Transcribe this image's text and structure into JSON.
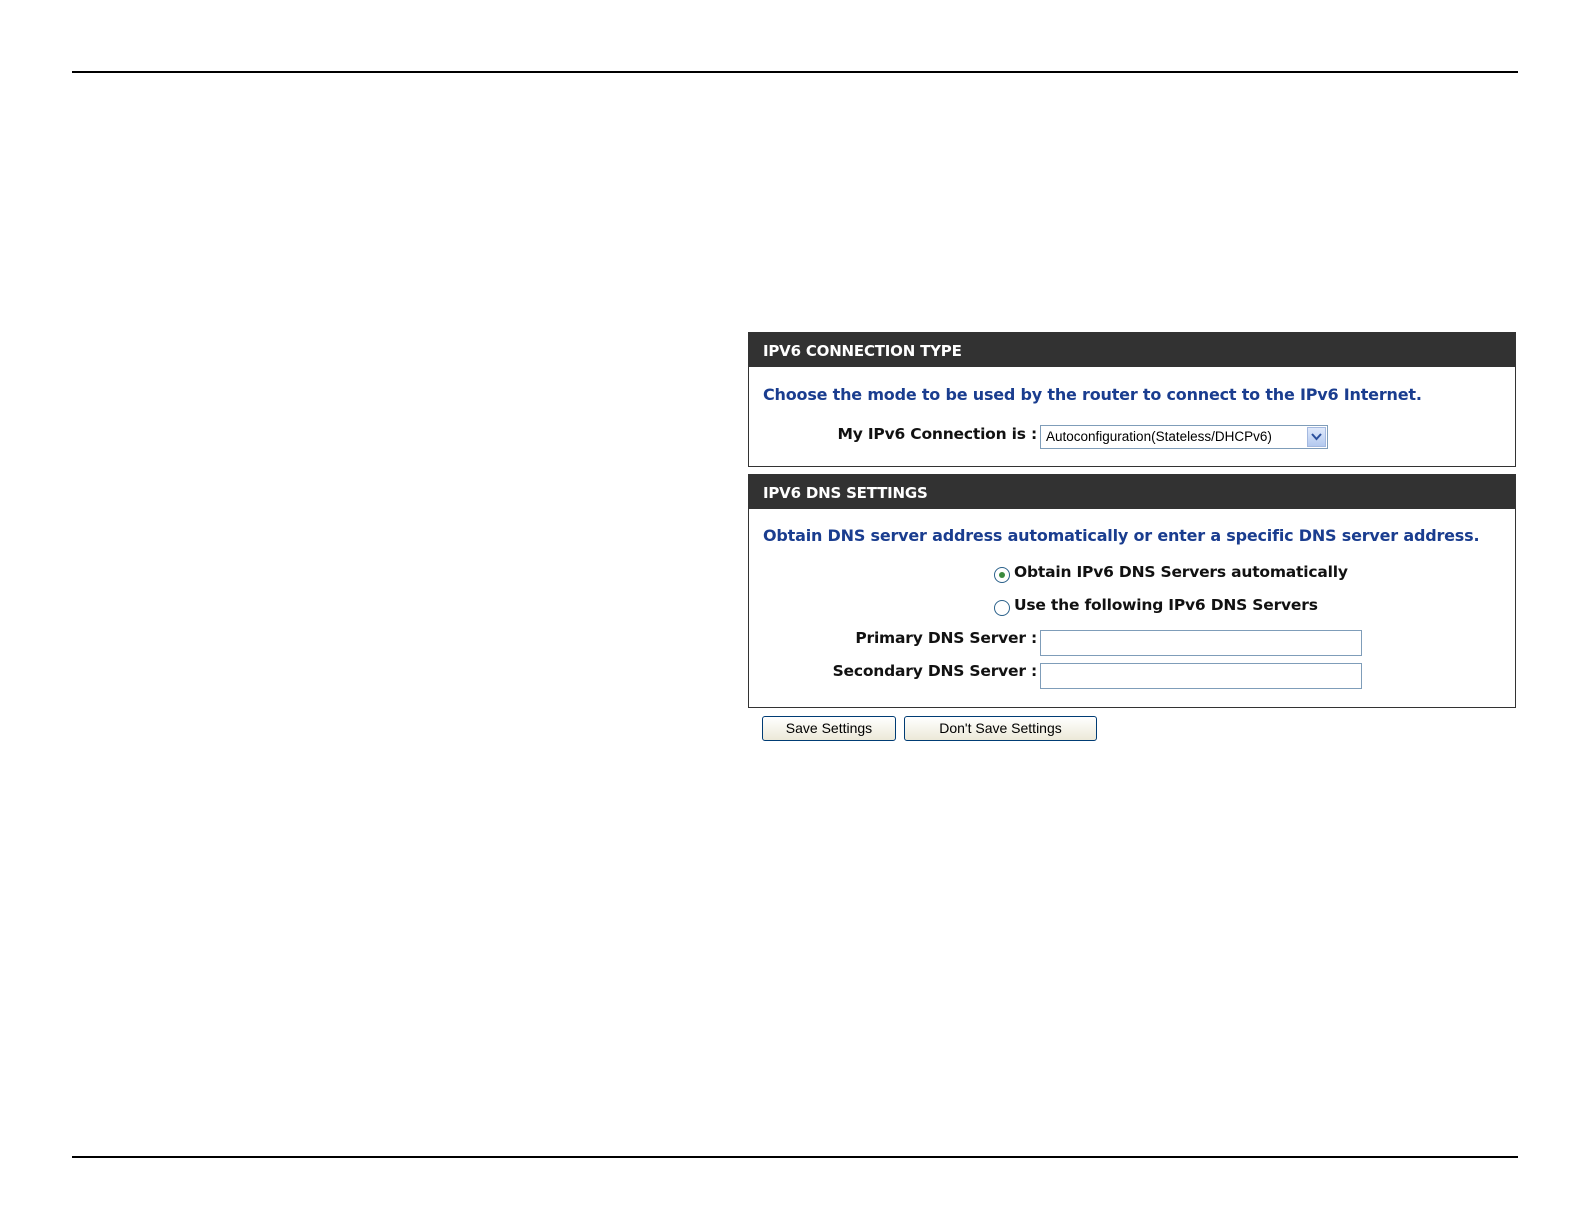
{
  "connection_type": {
    "header": "IPV6 CONNECTION TYPE",
    "intro": "Choose the mode to be used by the router to connect to the IPv6 Internet.",
    "label": "My IPv6 Connection is :",
    "selected": "Autoconfiguration(Stateless/DHCPv6)"
  },
  "dns_settings": {
    "header": "IPV6 DNS SETTINGS",
    "intro": "Obtain DNS server address automatically or enter a specific DNS server address.",
    "radio_auto": "Obtain IPv6 DNS Servers automatically",
    "radio_manual": "Use the following IPv6 DNS Servers",
    "selected_option": "auto",
    "primary_label": "Primary DNS Server :",
    "primary_value": "",
    "secondary_label": "Secondary DNS Server :",
    "secondary_value": ""
  },
  "buttons": {
    "save": "Save Settings",
    "dont_save": "Don't Save Settings"
  },
  "colors": {
    "header_bg": "#323232",
    "intro_text": "#1a3d8f"
  },
  "icons": {
    "dropdown": "chevron-down-icon"
  }
}
